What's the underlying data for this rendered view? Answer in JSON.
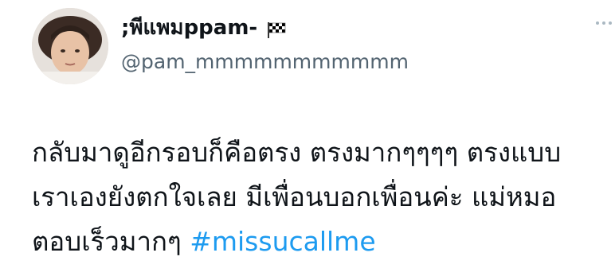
{
  "author": {
    "display_name": ";พีแพมppam-",
    "flag_emoji": "checkered-flag-icon",
    "handle": "@pam_mmmmmmmmmmm"
  },
  "tweet": {
    "line1": "กลับมาดูอีกรอบก็คือตรง ตรงมากๆๆๆๆ ตรงแบบ",
    "line2": "เราเองยังตกใจเลย มีเพื่อนบอกเพื่อนค่ะ แม่หมอ",
    "line3_text": "ตอบเร็วมากๆ ",
    "hashtag": "#missucallme"
  },
  "colors": {
    "hashtag": "#1d9bf0",
    "handle": "#536471",
    "text": "#0f1419"
  }
}
